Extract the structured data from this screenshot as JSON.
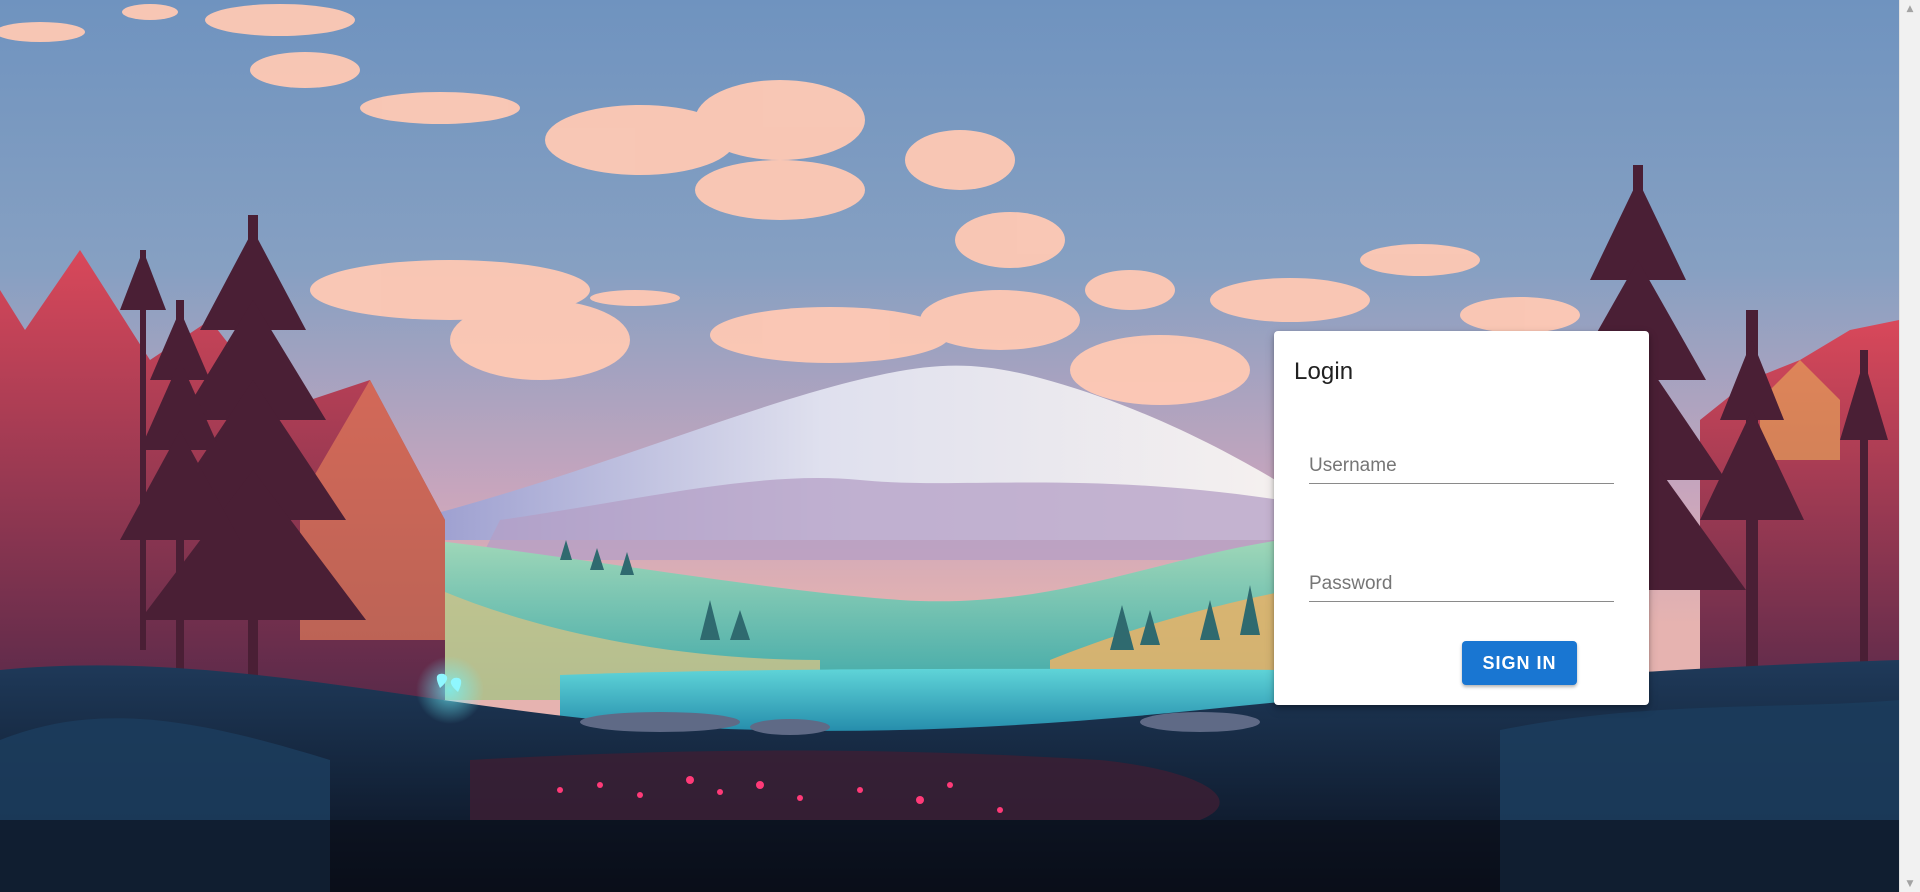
{
  "login": {
    "title": "Login",
    "username_placeholder": "Username",
    "username_value": "",
    "password_placeholder": "Password",
    "password_value": "",
    "submit_label": "SIGN IN"
  },
  "background": {
    "description_icon": "mountain-landscape-illustration",
    "colors": {
      "sky_top": "#6f93bf",
      "sky_bottom": "#c9a3b8",
      "cloud": "#ffc7b0",
      "mountain_snow": "#f3f1f2",
      "mountain_shadow": "#9f9cc6",
      "lake": "#2fb3c6",
      "foreground": "#1a2338",
      "trees_left": "#b3394a",
      "trees_right": "#a3384e"
    }
  },
  "scrollbar": {
    "up_icon": "arrow-up-icon",
    "down_icon": "arrow-down-icon"
  },
  "theme": {
    "accent": "#1976d2",
    "card_bg": "#ffffff"
  }
}
